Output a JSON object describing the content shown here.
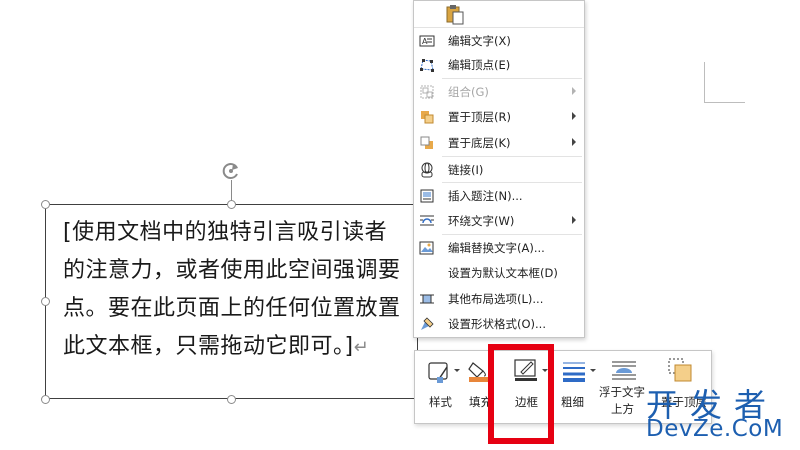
{
  "document": {
    "textbox_text": "[使用文档中的独特引言吸引读者的注意力，或者使用此空间强调要点。要在此页面上的任何位置放置此文本框，只需拖动它即可。]",
    "paragraph_mark": "↵"
  },
  "context_menu": {
    "items": [
      {
        "label": "编辑文字(X)",
        "icon": "edit-text-icon",
        "enabled": true,
        "submenu": false
      },
      {
        "label": "编辑顶点(E)",
        "icon": "edit-points-icon",
        "enabled": true,
        "submenu": false
      },
      {
        "label": "组合(G)",
        "icon": "group-icon",
        "enabled": false,
        "submenu": true
      },
      {
        "label": "置于顶层(R)",
        "icon": "bring-to-front-icon",
        "enabled": true,
        "submenu": true
      },
      {
        "label": "置于底层(K)",
        "icon": "send-to-back-icon",
        "enabled": true,
        "submenu": true
      },
      {
        "label": "链接(I)",
        "icon": "link-icon",
        "enabled": true,
        "submenu": false
      },
      {
        "label": "插入题注(N)...",
        "icon": "insert-caption-icon",
        "enabled": true,
        "submenu": false
      },
      {
        "label": "环绕文字(W)",
        "icon": "wrap-text-icon",
        "enabled": true,
        "submenu": true
      },
      {
        "label": "编辑替换文字(A)...",
        "icon": "alt-text-icon",
        "enabled": true,
        "submenu": false
      },
      {
        "label": "设置为默认文本框(D)",
        "icon": "",
        "enabled": true,
        "submenu": false
      },
      {
        "label": "其他布局选项(L)...",
        "icon": "layout-options-icon",
        "enabled": true,
        "submenu": false
      },
      {
        "label": "设置形状格式(O)...",
        "icon": "format-shape-icon",
        "enabled": true,
        "submenu": false
      }
    ]
  },
  "mini_toolbar": {
    "style_label": "样式",
    "fill_label": "填充",
    "outline_label": "边框",
    "weight_label": "粗细",
    "wrap_label_line1": "浮于文字",
    "wrap_label_line2": "上方",
    "front_label": "置于顶层"
  },
  "colors": {
    "highlight": "#e60012",
    "fill_swatch": "#e8863a",
    "weight_icon": "#2e6bc6",
    "watermark": "#1d5fb0"
  },
  "watermark": {
    "cn": "开发者",
    "en": "DevZe.CoM"
  }
}
